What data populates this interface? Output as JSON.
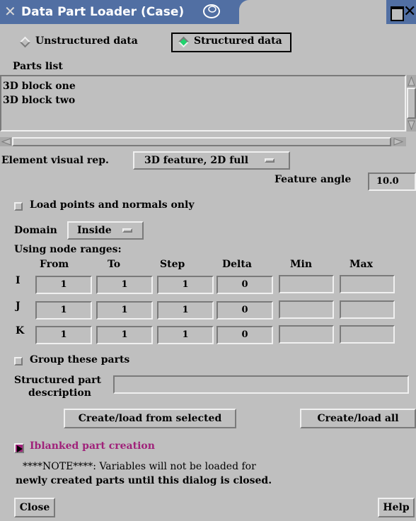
{
  "window": {
    "title": "Data Part Loader (Case)"
  },
  "data_type": {
    "options": [
      "Unstructured data",
      "Structured data"
    ],
    "selected": "Structured data"
  },
  "parts": {
    "label": "Parts list",
    "items": [
      "3D block one",
      "3D block two"
    ]
  },
  "visual_rep": {
    "label": "Element visual rep.",
    "value": "3D feature, 2D full"
  },
  "feature_angle": {
    "label": "Feature angle",
    "value": "10.0"
  },
  "load_points": {
    "label": "Load points and normals only",
    "checked": false
  },
  "domain": {
    "label": "Domain",
    "value": "Inside"
  },
  "ranges": {
    "label": "Using node ranges:",
    "columns": [
      "From",
      "To",
      "Step",
      "Delta",
      "Min",
      "Max"
    ],
    "rows": [
      {
        "axis": "I",
        "from": "1",
        "to": "1",
        "step": "1",
        "delta": "0"
      },
      {
        "axis": "J",
        "from": "1",
        "to": "1",
        "step": "1",
        "delta": "0"
      },
      {
        "axis": "K",
        "from": "1",
        "to": "1",
        "step": "1",
        "delta": "0"
      }
    ]
  },
  "group": {
    "label": "Group these parts",
    "checked": false
  },
  "description": {
    "label_line1": "Structured part",
    "label_line2": "description",
    "value": ""
  },
  "buttons": {
    "create_selected": "Create/load from selected",
    "create_all": "Create/load all",
    "close": "Close",
    "help": "Help"
  },
  "iblank": {
    "label": "Iblanked part creation",
    "color": "#a0227a"
  },
  "note": {
    "line1": "****NOTE****: Variables will not be loaded for",
    "line2": "newly created parts until this dialog is closed."
  },
  "colors": {
    "titlebar": "#516fa3",
    "background": "#bfbfbf",
    "radio_on": "#21d36e"
  }
}
